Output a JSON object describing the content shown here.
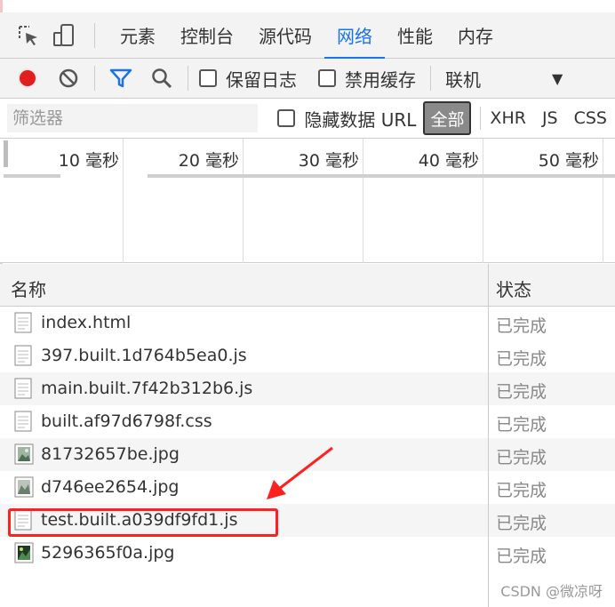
{
  "tabs": [
    {
      "label": "元素",
      "active": false
    },
    {
      "label": "控制台",
      "active": false
    },
    {
      "label": "源代码",
      "active": false
    },
    {
      "label": "网络",
      "active": true
    },
    {
      "label": "性能",
      "active": false
    },
    {
      "label": "内存",
      "active": false
    }
  ],
  "toolbar": {
    "preserve_log": "保留日志",
    "disable_cache": "禁用缓存",
    "throttle": "联机"
  },
  "filter": {
    "placeholder": "筛选器",
    "hide_data_urls": "隐藏数据 URL",
    "types": [
      "全部",
      "XHR",
      "JS",
      "CSS"
    ]
  },
  "timeline": {
    "labels": [
      "10 毫秒",
      "20 毫秒",
      "30 毫秒",
      "40 毫秒",
      "50 毫秒"
    ]
  },
  "table": {
    "headers": {
      "name": "名称",
      "status": "状态"
    },
    "rows": [
      {
        "name": "index.html",
        "status": "已完成",
        "icon": "document-icon"
      },
      {
        "name": "397.built.1d764b5ea0.js",
        "status": "已完成",
        "icon": "script-icon"
      },
      {
        "name": "main.built.7f42b312b6.js",
        "status": "已完成",
        "icon": "script-icon"
      },
      {
        "name": "built.af97d6798f.css",
        "status": "已完成",
        "icon": "stylesheet-icon"
      },
      {
        "name": "81732657be.jpg",
        "status": "已完成",
        "icon": "image-icon"
      },
      {
        "name": "d746ee2654.jpg",
        "status": "已完成",
        "icon": "image-icon"
      },
      {
        "name": "test.built.a039df9fd1.js",
        "status": "已完成",
        "icon": "script-icon"
      },
      {
        "name": "5296365f0a.jpg",
        "status": "已完成",
        "icon": "image-icon"
      }
    ]
  },
  "annotation": {
    "highlight_color": "#ff2020",
    "accent": "#1a73e8"
  },
  "watermark": "CSDN @微凉呀"
}
